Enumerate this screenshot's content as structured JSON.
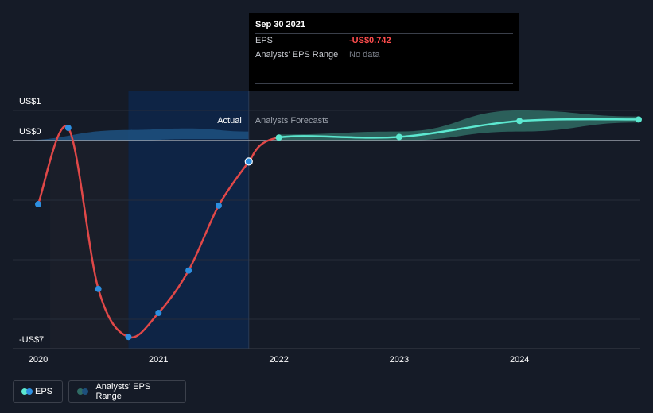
{
  "tooltip": {
    "date": "Sep 30 2021",
    "rows": [
      {
        "label": "EPS",
        "value": "-US$0.742"
      },
      {
        "label": "Analysts' EPS Range",
        "value": "No data"
      }
    ]
  },
  "regions": {
    "actual_label": "Actual",
    "forecast_label": "Analysts Forecasts"
  },
  "legend": {
    "eps_label": "EPS",
    "range_label": "Analysts' EPS Range"
  },
  "colors": {
    "background": "#151b27",
    "actual_line": "#e04848",
    "forecast_line": "#5ce8d0",
    "actual_point": "#2d8fe0",
    "forecast_point": "#5ce8d0",
    "forecast_band": "#2f6b64",
    "actual_band": "#1d4f7c",
    "highlight": "#0e2445"
  },
  "chart_data": {
    "type": "line",
    "x_ticks": [
      2020,
      2021,
      2022,
      2023,
      2024
    ],
    "x_tick_labels": [
      "2020",
      "2021",
      "2022",
      "2023",
      "2024"
    ],
    "y_tick_labels": [
      {
        "value": 1,
        "label": "US$1"
      },
      {
        "value": 0,
        "label": "US$0"
      },
      {
        "value": -7,
        "label": "-US$7"
      }
    ],
    "ylim": [
      -7,
      1
    ],
    "xlim": [
      2019.8,
      2024.99
    ],
    "grid": true,
    "legend_position": "bottom-left",
    "series": [
      {
        "name": "EPS",
        "role": "actual",
        "points": [
          {
            "x": 2020.0,
            "y": -2.25
          },
          {
            "x": 2020.25,
            "y": 0.42
          },
          {
            "x": 2020.5,
            "y": -5.25
          },
          {
            "x": 2020.75,
            "y": -6.95
          },
          {
            "x": 2021.0,
            "y": -6.1
          },
          {
            "x": 2021.25,
            "y": -4.6
          },
          {
            "x": 2021.5,
            "y": -2.3
          },
          {
            "x": 2021.75,
            "y": -0.742
          }
        ]
      },
      {
        "name": "EPS",
        "role": "forecast",
        "points": [
          {
            "x": 2021.75,
            "y": -0.742
          },
          {
            "x": 2022.0,
            "y": 0.1
          },
          {
            "x": 2023.0,
            "y": 0.12
          },
          {
            "x": 2024.0,
            "y": 0.65
          },
          {
            "x": 2024.99,
            "y": 0.7
          }
        ]
      }
    ],
    "actual_band": [
      {
        "x": 2019.8,
        "low": 0.0,
        "high": 0.0
      },
      {
        "x": 2020.75,
        "low": 0.0,
        "high": 0.35
      },
      {
        "x": 2021.25,
        "low": 0.05,
        "high": 0.4
      },
      {
        "x": 2021.75,
        "low": 0.05,
        "high": 0.3
      }
    ],
    "forecast_band": [
      {
        "x": 2022.0,
        "low": 0.0,
        "high": 0.2
      },
      {
        "x": 2023.0,
        "low": 0.0,
        "high": 0.3
      },
      {
        "x": 2024.0,
        "low": 0.3,
        "high": 1.0
      },
      {
        "x": 2024.99,
        "low": 0.6,
        "high": 0.8
      }
    ],
    "actual_cutoff_x": 2021.75
  }
}
